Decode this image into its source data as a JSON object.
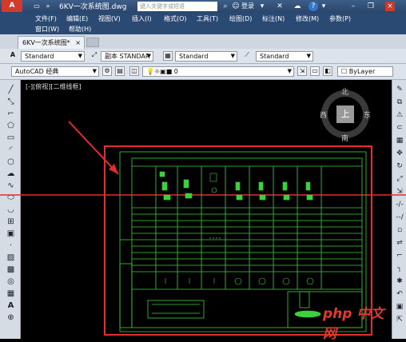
{
  "titlebar": {
    "app_button": "A",
    "doc_title": "6KV一次系统图.dwg",
    "search_placeholder": "键入关键字或短语",
    "login": "登录",
    "help": "?"
  },
  "menu": {
    "row1": [
      "文件(F)",
      "编辑(E)",
      "视图(V)",
      "插入(I)",
      "格式(O)",
      "工具(T)",
      "绘图(D)",
      "标注(N)",
      "修改(M)",
      "参数(P)"
    ],
    "row2": [
      "窗口(W)",
      "帮助(H)"
    ]
  },
  "tabs": [
    {
      "label": "6KV一次系统图*",
      "close": "×"
    }
  ],
  "toolbar1": {
    "text_style": "Standard",
    "dim_style": "副本 STANDAR",
    "table_style": "Standard",
    "multileader_style": "Standard"
  },
  "toolbar2": {
    "workspace": "AutoCAD 经典",
    "layer": "0",
    "color": "ByLayer"
  },
  "viewport_label": "[-][俯视][二维线框]",
  "viewcube": {
    "north": "北",
    "south": "南",
    "west": "西",
    "east": "东",
    "top": "上"
  },
  "watermark": "php 中文网"
}
